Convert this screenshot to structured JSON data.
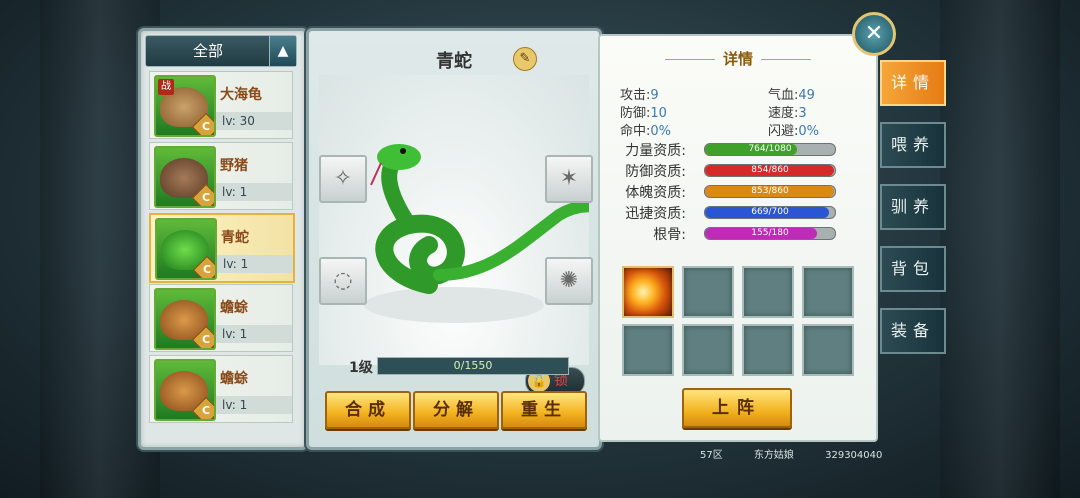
{
  "filter": {
    "label": "全部",
    "toggle_icon": "▲"
  },
  "pets": [
    {
      "name": "大海龟",
      "level": "lv: 30",
      "badge": "C",
      "war_tag": "战",
      "selected": false
    },
    {
      "name": "野猪",
      "level": "lv: 1",
      "badge": "C",
      "selected": false
    },
    {
      "name": "青蛇",
      "level": "lv: 1",
      "badge": "C",
      "selected": true
    },
    {
      "name": "蟾蜍",
      "level": "lv: 1",
      "badge": "C",
      "selected": false
    },
    {
      "name": "蟾蜍",
      "level": "lv: 1",
      "badge": "C",
      "selected": false
    }
  ],
  "center": {
    "pet_title": "青蛇",
    "rename_icon": "✎",
    "lock_label": "锁",
    "lock_icon": "🔓",
    "level_label": "1级",
    "exp_text": "0/1550",
    "buttons": {
      "compose": "合成",
      "decompose": "分解",
      "reborn": "重生"
    }
  },
  "detail": {
    "title": "详情",
    "stats": {
      "attack_label": "攻击:",
      "attack": "9",
      "hp_label": "气血:",
      "hp": "49",
      "defense_label": "防御:",
      "defense": "10",
      "speed_label": "速度:",
      "speed": "3",
      "hit_label": "命中:",
      "hit": "0%",
      "dodge_label": "闪避:",
      "dodge": "0%"
    },
    "aptitudes": [
      {
        "label": "力量资质:",
        "text": "764/1080",
        "ratio": 0.707,
        "color": "#3fa02a"
      },
      {
        "label": "防御资质:",
        "text": "854/860",
        "ratio": 0.993,
        "color": "#d42a2a"
      },
      {
        "label": "体魄资质:",
        "text": "853/860",
        "ratio": 0.992,
        "color": "#d98a12"
      },
      {
        "label": "迅捷资质:",
        "text": "669/700",
        "ratio": 0.956,
        "color": "#2a56d4"
      },
      {
        "label": "根骨:",
        "text": "155/180",
        "ratio": 0.861,
        "color": "#c02ab8"
      }
    ],
    "deploy_label": "上阵"
  },
  "tabs": [
    "详情",
    "喂养",
    "驯养",
    "背包",
    "装备"
  ],
  "footer": {
    "zone": "57区",
    "player": "东方姑娘",
    "id": "329304040"
  }
}
